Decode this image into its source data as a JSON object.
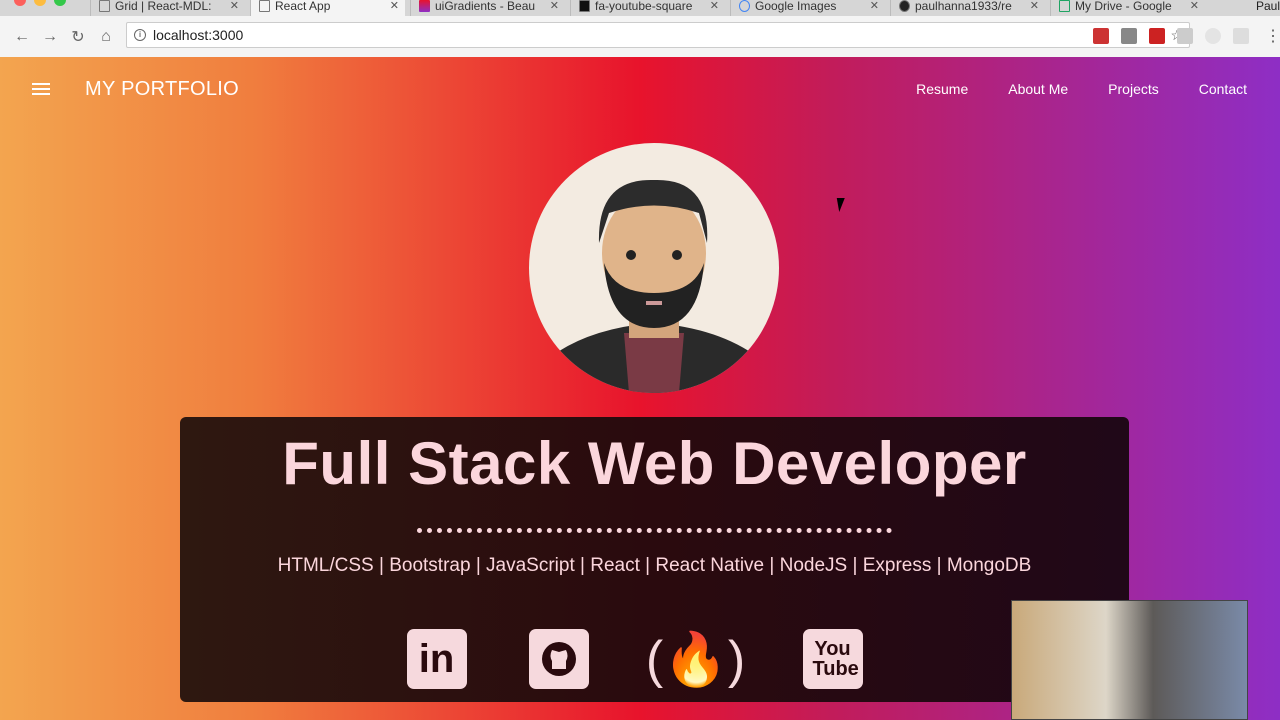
{
  "browser": {
    "tabs": [
      {
        "title": "Grid | React-MDL:"
      },
      {
        "title": "React App",
        "active": true
      },
      {
        "title": "uiGradients - Beau"
      },
      {
        "title": "fa-youtube-square"
      },
      {
        "title": "Google Images"
      },
      {
        "title": "paulhanna1933/re"
      },
      {
        "title": "My Drive - Google"
      }
    ],
    "profile": "Paul",
    "url": "localhost:3000"
  },
  "header": {
    "title": "MY PORTFOLIO",
    "nav": [
      "Resume",
      "About Me",
      "Projects",
      "Contact"
    ]
  },
  "banner": {
    "heading": "Full Stack Web Developer",
    "skills": "HTML/CSS | Bootstrap | JavaScript | React | React Native | NodeJS | Express | MongoDB",
    "social": [
      {
        "icon": "linkedin-icon",
        "label": "in"
      },
      {
        "icon": "github-icon"
      },
      {
        "icon": "freecodecamp-icon"
      },
      {
        "icon": "youtube-icon",
        "label": "You Tube"
      }
    ]
  },
  "colors": {
    "gradient": [
      "#f3a54f",
      "#e8132c",
      "#8e2ec5"
    ],
    "banner_text": "#fbd6dc"
  }
}
